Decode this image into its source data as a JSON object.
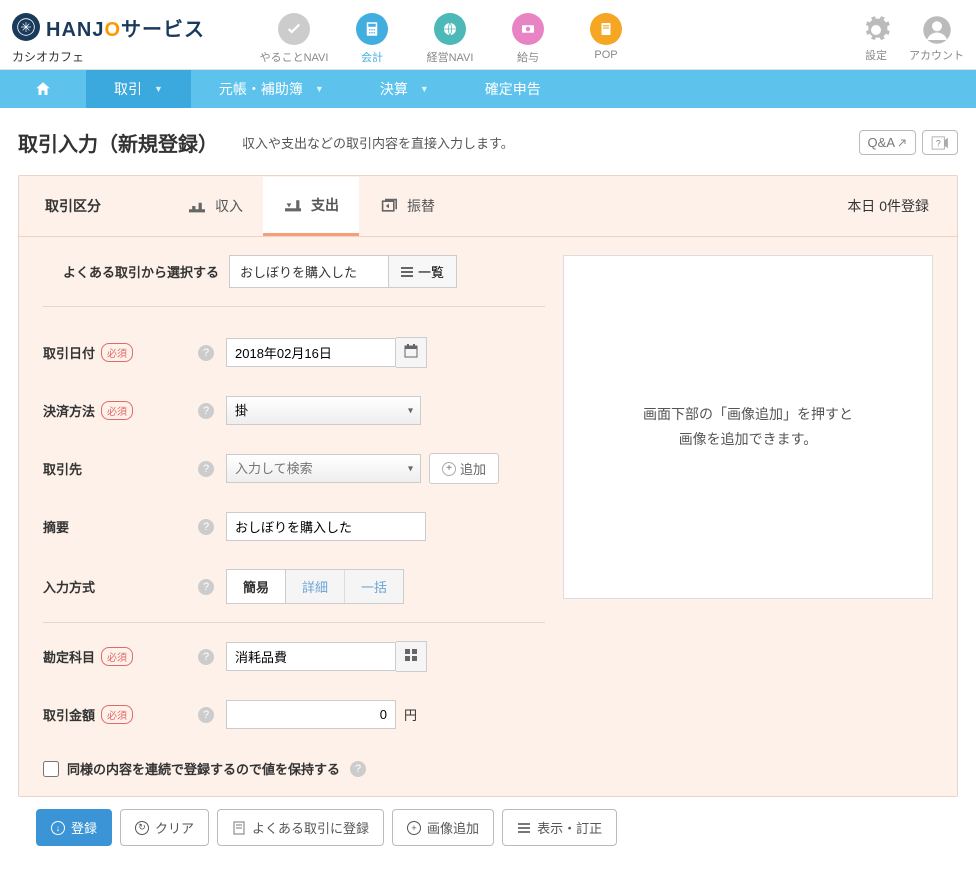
{
  "header": {
    "brand_h": "HANJ",
    "brand_o": "O",
    "brand_suffix": "サービス",
    "company": "カシオカフェ",
    "nav": [
      {
        "label": "やることNAVI"
      },
      {
        "label": "会計"
      },
      {
        "label": "経営NAVI"
      },
      {
        "label": "給与"
      },
      {
        "label": "POP"
      }
    ],
    "right": [
      {
        "label": "設定"
      },
      {
        "label": "アカウント"
      }
    ]
  },
  "subnav": {
    "items": [
      "取引",
      "元帳・補助簿",
      "決算",
      "確定申告"
    ]
  },
  "page": {
    "title": "取引入力（新規登録）",
    "desc": "収入や支出などの取引内容を直接入力します。",
    "qa": "Q&A"
  },
  "tabs": {
    "label": "取引区分",
    "items": [
      "収入",
      "支出",
      "振替"
    ],
    "today_status": "本日 0件登録"
  },
  "quick": {
    "label": "よくある取引から選択する",
    "value": "おしぼりを購入した",
    "list_btn": "一覧"
  },
  "fields": {
    "date_label": "取引日付",
    "date_value": "2018年02月16日",
    "payment_label": "決済方法",
    "payment_value": "掛",
    "partner_label": "取引先",
    "partner_placeholder": "入力して検索",
    "add_btn": "追加",
    "summary_label": "摘要",
    "summary_value": "おしぼりを購入した",
    "entry_label": "入力方式",
    "entry_tabs": [
      "簡易",
      "詳細",
      "一括"
    ],
    "account_label": "勘定科目",
    "account_value": "消耗品費",
    "amount_label": "取引金額",
    "amount_value": "0",
    "amount_unit": "円",
    "required": "必須"
  },
  "image_panel": {
    "line1": "画面下部の「画像追加」を押すと",
    "line2": "画像を追加できます。"
  },
  "keep": {
    "label": "同様の内容を連続で登録するので値を保持する"
  },
  "footer": {
    "register": "登録",
    "clear": "クリア",
    "save_template": "よくある取引に登録",
    "add_image": "画像追加",
    "view_edit": "表示・訂正"
  }
}
